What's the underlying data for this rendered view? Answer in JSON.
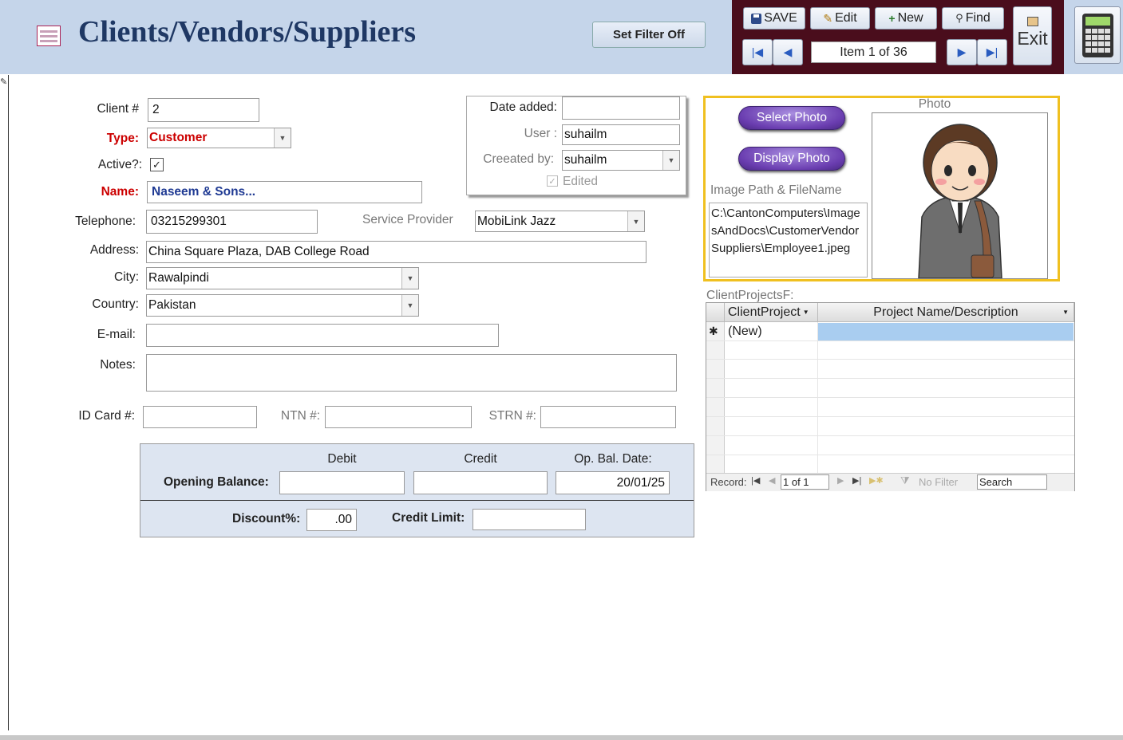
{
  "header": {
    "title": "Clients/Vendors/Suppliers",
    "filter_button": "Set Filter Off"
  },
  "toolbar": {
    "save": "SAVE",
    "edit": "Edit",
    "new": "New",
    "find": "Find",
    "exit": "Exit",
    "record_position": "Item 1 of 36"
  },
  "form": {
    "client_no_label": "Client #",
    "client_no": "2",
    "type_label": "Type:",
    "type_value": "Customer",
    "active_label": "Active?:",
    "active_checked": true,
    "name_label": "Name:",
    "name_value": "Naseem & Sons...",
    "telephone_label": "Telephone:",
    "telephone_value": "03215299301",
    "service_provider_label": "Service Provider",
    "service_provider_value": "MobiLink Jazz",
    "address_label": "Address:",
    "address_value": "China Square Plaza, DAB College Road",
    "city_label": "City:",
    "city_value": "Rawalpindi",
    "country_label": "Country:",
    "country_value": "Pakistan",
    "email_label": "E-mail:",
    "email_value": "",
    "notes_label": "Notes:",
    "notes_value": "",
    "id_card_label": "ID Card #:",
    "id_card_value": "",
    "ntn_label": "NTN #:",
    "ntn_value": "",
    "strn_label": "STRN #:",
    "strn_value": ""
  },
  "audit": {
    "date_added_label": "Date added:",
    "date_added_value": "",
    "user_label": "User :",
    "user_value": "suhailm",
    "created_by_label": "Creeated by:",
    "created_by_value": "suhailm",
    "edited_label": "Edited",
    "edited_checked": true
  },
  "balance": {
    "debit_label": "Debit",
    "credit_label": "Credit",
    "date_label": "Op. Bal. Date:",
    "opening_label": "Opening Balance:",
    "debit_value": "",
    "credit_value": "",
    "date_value": "20/01/25",
    "discount_label": "Discount%:",
    "discount_value": ".00",
    "credit_limit_label": "Credit Limit:",
    "credit_limit_value": ""
  },
  "photo": {
    "select_button": "Select Photo",
    "display_button": "Display Photo",
    "caption": "Photo",
    "path_label": "Image Path & FileName",
    "path_value": "C:\\CantonComputers\\ImagesAndDocs\\CustomerVendorSuppliers\\Employee1.jpeg"
  },
  "subform": {
    "label": "ClientProjectsF:",
    "columns": [
      "ClientProject",
      "Project Name/Description"
    ],
    "new_row": "(New)",
    "record_label": "Record:",
    "record_value": "1 of 1",
    "filter_status": "No Filter",
    "search_placeholder": "Search"
  },
  "colors": {
    "header_bg": "#c5d5ea",
    "title": "#1f3864",
    "nav_panel": "#4a0d1c",
    "required_label": "#cc0000",
    "photo_border": "#f0c020"
  }
}
